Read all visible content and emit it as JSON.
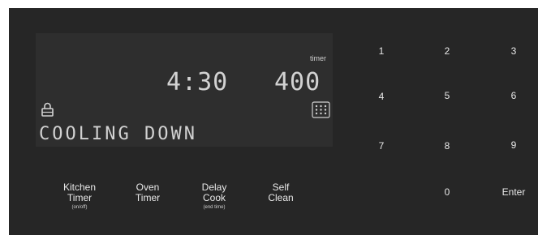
{
  "display": {
    "time": "4:30",
    "temperature": "400",
    "timer_label": "timer",
    "status": "COOLING DOWN",
    "icons": {
      "lock": "lock-icon",
      "burner": "burner-grid-icon"
    }
  },
  "keypad": {
    "k1": "1",
    "k2": "2",
    "k3": "3",
    "k4": "4",
    "k5": "5",
    "k6": "6",
    "k7": "7",
    "k8": "8",
    "k9": "9",
    "k0": "0",
    "enter": "Enter"
  },
  "functions": {
    "kitchen_timer": {
      "line1": "Kitchen",
      "line2": "Timer",
      "sub": "(on/off)"
    },
    "oven_timer": {
      "line1": "Oven",
      "line2": "Timer"
    },
    "delay_cook": {
      "line1": "Delay",
      "line2": "Cook",
      "sub": "(end time)"
    },
    "self_clean": {
      "line1": "Self",
      "line2": "Clean"
    }
  },
  "colors": {
    "panel": "#262626",
    "display": "#2e2e2e",
    "text": "#e8e8e8",
    "lcd": "#d2d2d2"
  }
}
